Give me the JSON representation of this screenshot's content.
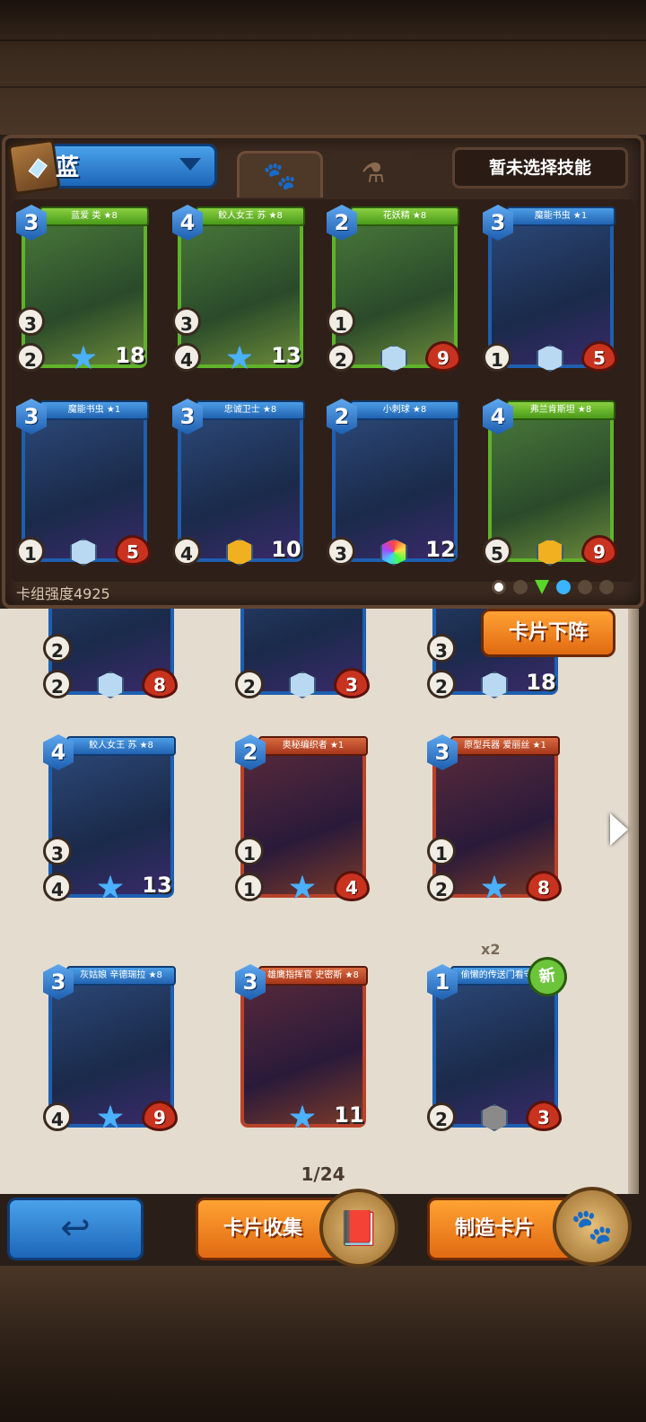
{
  "deck": {
    "name": "蓝",
    "skill_button": "暂未选择技能",
    "power_label": "卡组强度4925",
    "tabs": [
      {
        "icon": "paw-icon",
        "glyph": "🐾"
      },
      {
        "icon": "potion-icon",
        "glyph": "⚗"
      }
    ],
    "cards": [
      {
        "name": "蓝爱 类 ★8",
        "cost": "3",
        "atk": "2",
        "extra": "3",
        "hp": "18",
        "style": "green",
        "gem": "star"
      },
      {
        "name": "鲛人女王 苏 ★8",
        "cost": "4",
        "atk": "4",
        "extra": "3",
        "hp": "13",
        "style": "green",
        "gem": "star"
      },
      {
        "name": "花妖精 ★8",
        "cost": "2",
        "atk": "2",
        "extra": "1",
        "hp": "9",
        "style": "green",
        "gem": "plain"
      },
      {
        "name": "魔能书虫 ★1",
        "cost": "3",
        "atk": "1",
        "extra": "",
        "hp": "5",
        "style": "blue",
        "gem": "plain"
      },
      {
        "name": "魔能书虫 ★1",
        "cost": "3",
        "atk": "1",
        "extra": "",
        "hp": "5",
        "style": "blue",
        "gem": "plain"
      },
      {
        "name": "忠诚卫士 ★8",
        "cost": "3",
        "atk": "4",
        "extra": "",
        "hp": "10",
        "style": "blue",
        "gem": "gold"
      },
      {
        "name": "小刺球 ★8",
        "cost": "2",
        "atk": "3",
        "extra": "",
        "hp": "12",
        "style": "blue",
        "gem": "rainbow"
      },
      {
        "name": "弗兰肯斯坦 ★8",
        "cost": "4",
        "atk": "5",
        "extra": "",
        "hp": "9",
        "style": "green",
        "gem": "gold"
      }
    ]
  },
  "collection": {
    "remove_button": "卡片下阵",
    "partial_row": [
      {
        "atk": "2",
        "extra": "2",
        "hp": "8",
        "style": "blue"
      },
      {
        "atk": "2",
        "extra": "",
        "hp": "3",
        "style": "blue"
      },
      {
        "atk": "2",
        "extra": "3",
        "hp": "18",
        "style": "blue"
      }
    ],
    "cards": [
      {
        "name": "鲛人女王 苏 ★8",
        "cost": "4",
        "atk": "4",
        "extra": "3",
        "hp": "13",
        "style": "blue",
        "gem": "star",
        "badge": "",
        "count": ""
      },
      {
        "name": "奥秘编织者 ★1",
        "cost": "2",
        "atk": "1",
        "extra": "1",
        "hp": "4",
        "style": "red",
        "gem": "star",
        "badge": "",
        "count": ""
      },
      {
        "name": "原型兵器 爱丽丝 ★1",
        "cost": "3",
        "atk": "2",
        "extra": "1",
        "hp": "8",
        "style": "red",
        "gem": "star",
        "badge": "",
        "count": ""
      },
      {
        "name": "灰姑娘 辛德瑞拉 ★8",
        "cost": "3",
        "atk": "4",
        "extra": "",
        "hp": "9",
        "style": "blue",
        "gem": "star",
        "badge": "",
        "count": ""
      },
      {
        "name": "雄鹰指挥官 史密斯 ★8",
        "cost": "3",
        "atk": "",
        "extra": "",
        "hp": "11",
        "style": "red",
        "gem": "star",
        "badge": "",
        "count": ""
      },
      {
        "name": "偷懒的传送门看守 ★1",
        "cost": "1",
        "atk": "2",
        "extra": "",
        "hp": "3",
        "style": "blue",
        "gem": "grey",
        "badge": "新",
        "count": "x2"
      }
    ],
    "pager": "1/24"
  },
  "bottom": {
    "back_icon": "back-arrow-icon",
    "back_glyph": "↩",
    "collect_label": "卡片收集",
    "craft_label": "制造卡片",
    "collect_icon_glyph": "📕",
    "craft_icon_glyph": "🐾"
  },
  "colors": {
    "blue_frame": "#1e5fb0",
    "green_frame": "#5fb32a",
    "red_frame": "#b8432a",
    "orange_button": "#e06a12",
    "panel_brown": "#3b2a20"
  }
}
